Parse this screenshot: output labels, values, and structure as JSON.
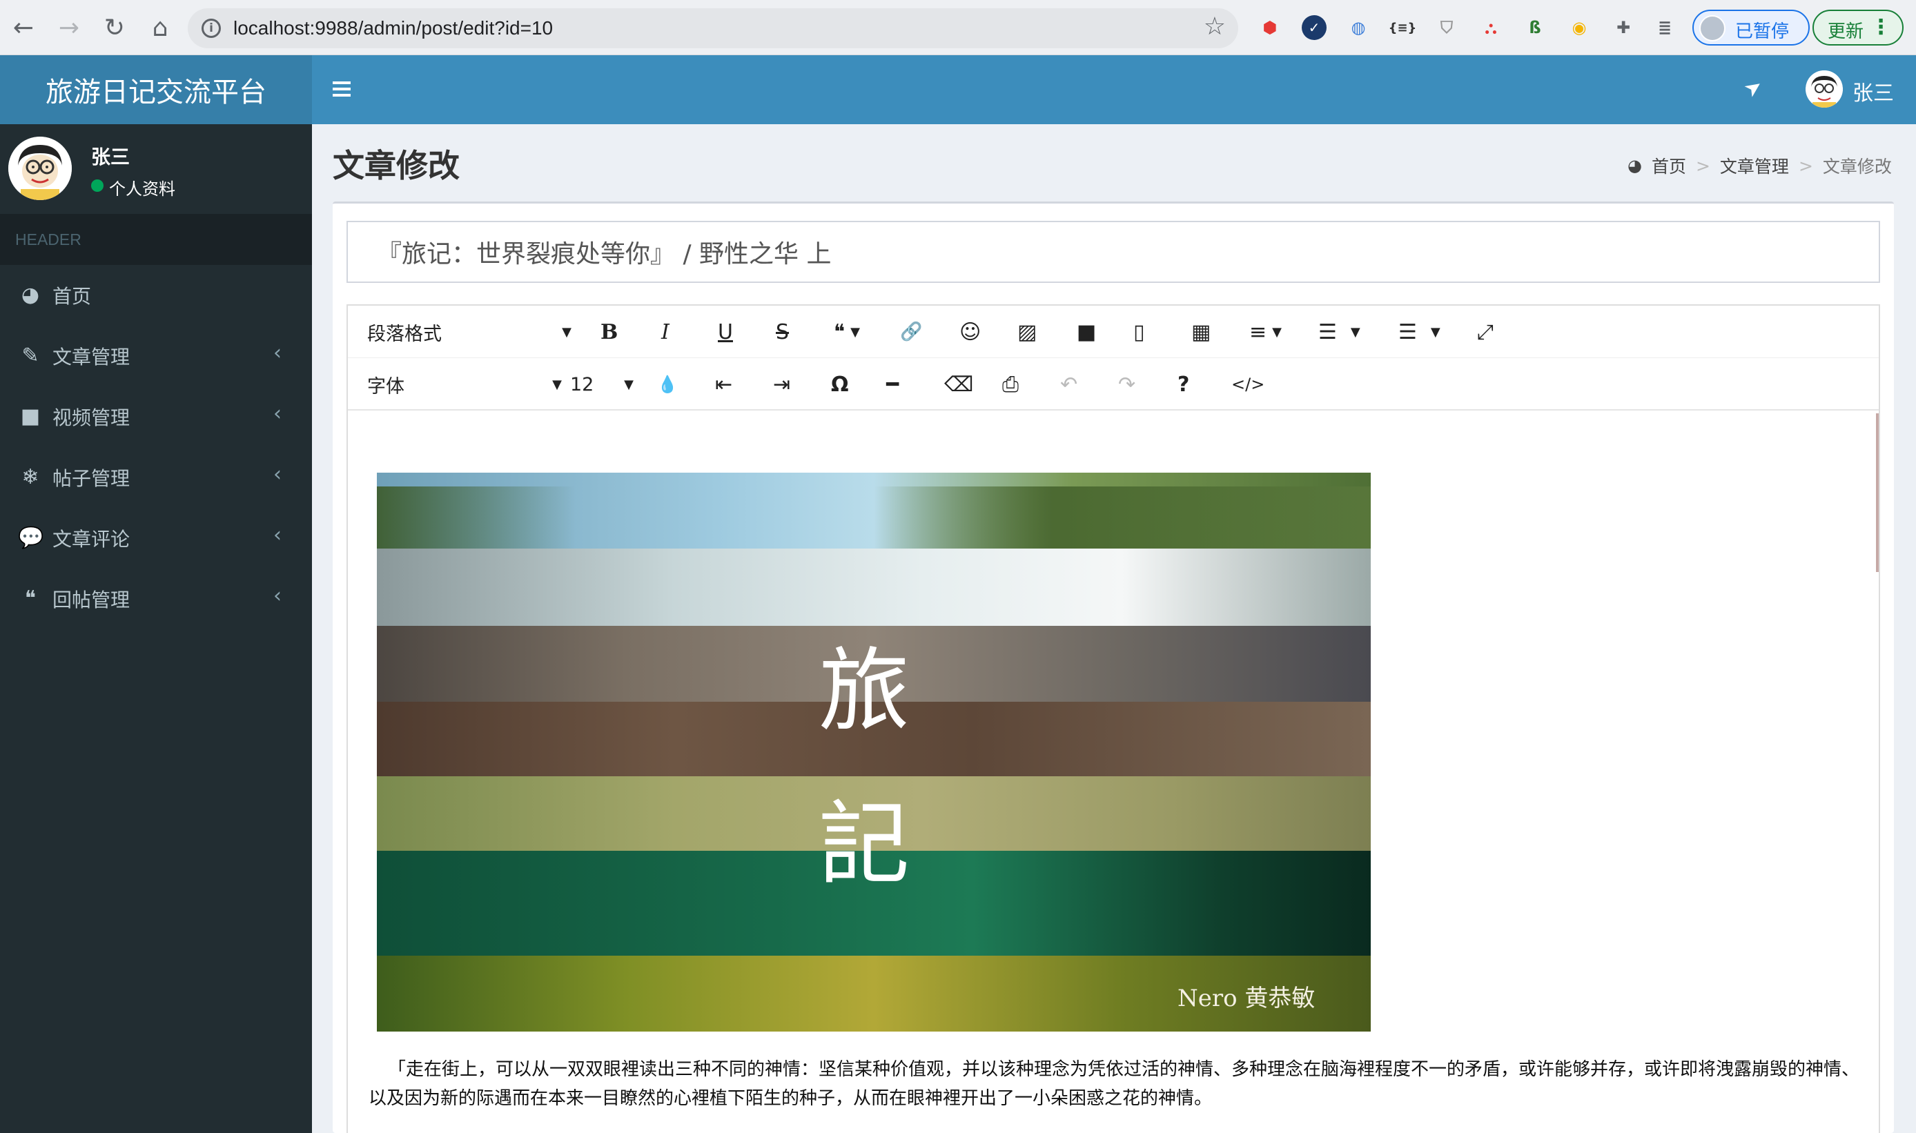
{
  "browser": {
    "url": "localhost:9988/admin/post/edit?id=10",
    "profile_label": "已暂停",
    "update_label": "更新"
  },
  "app": {
    "logo_text": "旅游日记交流平台",
    "user_name": "张三"
  },
  "sidebar": {
    "user_name": "张三",
    "profile_link": "个人资料",
    "header": "HEADER",
    "items": [
      {
        "label": "首页",
        "icon": "dashboard-icon",
        "glyph": "◕",
        "has_children": false
      },
      {
        "label": "文章管理",
        "icon": "paint-brush-icon",
        "glyph": "✎",
        "has_children": true
      },
      {
        "label": "视频管理",
        "icon": "video-camera-icon",
        "glyph": "■",
        "has_children": true
      },
      {
        "label": "帖子管理",
        "icon": "snowflake-icon",
        "glyph": "❄",
        "has_children": true
      },
      {
        "label": "文章评论",
        "icon": "comments-icon",
        "glyph": "💬",
        "has_children": true
      },
      {
        "label": "回帖管理",
        "icon": "quote-left-icon",
        "glyph": "❝",
        "has_children": true
      }
    ]
  },
  "content": {
    "page_title": "文章修改",
    "breadcrumb": [
      "首页",
      "文章管理",
      "文章修改"
    ]
  },
  "form": {
    "title_value": "『旅记：世界裂痕处等你』 / 野性之华 上"
  },
  "toolbar": {
    "row1": [
      {
        "name": "paragraph-format-select",
        "label": "段落格式",
        "caret": true
      },
      {
        "name": "bold-icon",
        "label": "B"
      },
      {
        "name": "italic-icon",
        "label": "I"
      },
      {
        "name": "underline-icon",
        "label": "U"
      },
      {
        "name": "strikethrough-icon",
        "label": "S"
      },
      {
        "name": "quote-icon",
        "label": "❝",
        "caret": true
      },
      {
        "name": "link-icon",
        "label": "🔗"
      },
      {
        "name": "emoticon-icon",
        "label": "☺"
      },
      {
        "name": "image-icon",
        "label": "▨"
      },
      {
        "name": "video-icon",
        "label": "■"
      },
      {
        "name": "file-icon",
        "label": "▯"
      },
      {
        "name": "table-icon",
        "label": "▦"
      },
      {
        "name": "align-icon",
        "label": "≡",
        "caret": true
      },
      {
        "name": "ordered-list-icon",
        "label": "☰",
        "caret": true
      },
      {
        "name": "unordered-list-icon",
        "label": "☰",
        "caret": true
      },
      {
        "name": "fullscreen-icon",
        "label": "⤢"
      }
    ],
    "row2": [
      {
        "name": "font-family-select",
        "label": "字体",
        "caret": true
      },
      {
        "name": "font-size-select",
        "label": "12",
        "caret": true
      },
      {
        "name": "font-color-icon",
        "label": "💧"
      },
      {
        "name": "outdent-icon",
        "label": "⇤"
      },
      {
        "name": "indent-icon",
        "label": "⇥"
      },
      {
        "name": "special-char-icon",
        "label": "Ω"
      },
      {
        "name": "horizontal-rule-icon",
        "label": "━"
      },
      {
        "name": "clear-format-icon",
        "label": "⌫"
      },
      {
        "name": "print-icon",
        "label": "⎙"
      },
      {
        "name": "undo-icon",
        "label": "↶",
        "disabled": true
      },
      {
        "name": "redo-icon",
        "label": "↷",
        "disabled": true
      },
      {
        "name": "help-icon",
        "label": "?"
      },
      {
        "name": "code-view-icon",
        "label": "</>"
      }
    ]
  },
  "article": {
    "hero_char_1": "旅",
    "hero_char_2": "記",
    "hero_author": "Nero 黄恭敏",
    "paragraph": "「走在街上，可以从一双双眼裡读出三种不同的神情：坚信某种价值观，并以该种理念为凭依过活的神情、多种理念在脑海裡程度不一的矛盾，或许能够并存，或许即将洩露崩毁的神情、以及因为新的际遇而在本来一目瞭然的心裡植下陌生的种子，从而在眼神裡开出了一小朵困惑之花的神情。"
  },
  "colors": {
    "header_blue": "#3c8dbc",
    "logo_blue": "#367fa9",
    "sidebar_dark": "#222d32",
    "online_green": "#00a65a"
  }
}
